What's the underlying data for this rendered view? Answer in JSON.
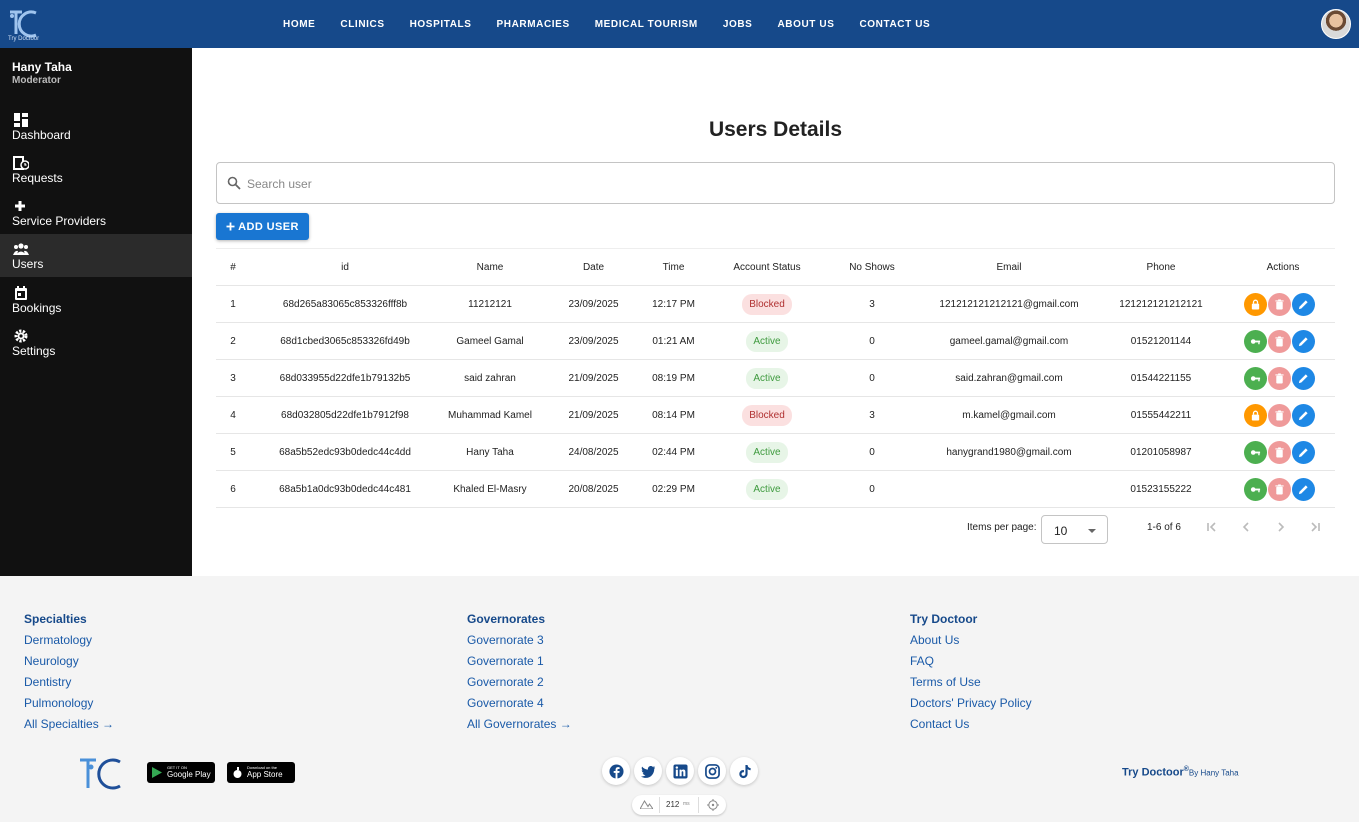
{
  "app": {
    "logo_text": "Try Doctoor",
    "nav": [
      "HOME",
      "CLINICS",
      "HOSPITALS",
      "PHARMACIES",
      "MEDICAL TOURISM",
      "JOBS",
      "ABOUT US",
      "CONTACT US"
    ]
  },
  "sidebar": {
    "user_name": "Hany Taha",
    "user_role": "Moderator",
    "items": [
      {
        "label": "Dashboard",
        "icon": "dashboard-icon"
      },
      {
        "label": "Requests",
        "icon": "requests-icon"
      },
      {
        "label": "Service Providers",
        "icon": "plus-icon"
      },
      {
        "label": "Users",
        "icon": "users-icon"
      },
      {
        "label": "Bookings",
        "icon": "calendar-icon"
      },
      {
        "label": "Settings",
        "icon": "gear-icon"
      }
    ],
    "active_index": 3
  },
  "main": {
    "title": "Users Details",
    "search_placeholder": "Search user",
    "add_button": "ADD USER",
    "columns": [
      "#",
      "id",
      "Name",
      "Date",
      "Time",
      "Account Status",
      "No Shows",
      "Email",
      "Phone",
      "Actions"
    ],
    "rows": [
      {
        "n": "1",
        "id": "68d265a83065c853326fff8b",
        "name": "11212121",
        "date": "23/09/2025",
        "time": "12:17 PM",
        "status": "Blocked",
        "no_shows": "3",
        "email": "121212121212121@gmail.com",
        "phone": "121212121212121"
      },
      {
        "n": "2",
        "id": "68d1cbed3065c853326fd49b",
        "name": "Gameel Gamal",
        "date": "23/09/2025",
        "time": "01:21 AM",
        "status": "Active",
        "no_shows": "0",
        "email": "gameel.gamal@gmail.com",
        "phone": "01521201144"
      },
      {
        "n": "3",
        "id": "68d033955d22dfe1b79132b5",
        "name": "said zahran",
        "date": "21/09/2025",
        "time": "08:19 PM",
        "status": "Active",
        "no_shows": "0",
        "email": "said.zahran@gmail.com",
        "phone": "01544221155"
      },
      {
        "n": "4",
        "id": "68d032805d22dfe1b7912f98",
        "name": "Muhammad Kamel",
        "date": "21/09/2025",
        "time": "08:14 PM",
        "status": "Blocked",
        "no_shows": "3",
        "email": "m.kamel@gmail.com",
        "phone": "01555442211"
      },
      {
        "n": "5",
        "id": "68a5b52edc93b0dedc44c4dd",
        "name": "Hany Taha",
        "date": "24/08/2025",
        "time": "02:44 PM",
        "status": "Active",
        "no_shows": "0",
        "email": "hanygrand1980@gmail.com",
        "phone": "01201058987"
      },
      {
        "n": "6",
        "id": "68a5b1a0dc93b0dedc44c481",
        "name": "Khaled El-Masry",
        "date": "20/08/2025",
        "time": "02:29 PM",
        "status": "Active",
        "no_shows": "0",
        "email": "",
        "phone": "01523155222"
      }
    ],
    "pager": {
      "items_per_page_label": "Items per page:",
      "items_per_page": "10",
      "range": "1-6 of 6"
    }
  },
  "footer": {
    "specialties": {
      "title": "Specialties",
      "links": [
        "Dermatology",
        "Neurology",
        "Dentistry",
        "Pulmonology",
        "All Specialties →"
      ]
    },
    "governorates": {
      "title": "Governorates",
      "links": [
        "Governorate 3",
        "Governorate 1",
        "Governorate 2",
        "Governorate 4",
        "All Governorates →"
      ]
    },
    "company": {
      "title": "Try Doctoor",
      "links": [
        "About Us",
        "FAQ",
        "Terms of Use",
        "Doctors' Privacy Policy",
        "Contact Us"
      ]
    },
    "google_play": {
      "small": "GET IT ON",
      "big": "Google Play"
    },
    "app_store": {
      "small": "Download on the",
      "big": "App Store"
    },
    "devbar_ms": "212",
    "devbar_unit": "ms",
    "brand": "Try Doctoor",
    "brand_mark": "®",
    "brand_by": "By Hany Taha"
  },
  "colors": {
    "nav_bg": "#16498a",
    "primary": "#1976d2",
    "sidebar_bg": "#111111",
    "blocked": "#b03030",
    "active": "#3e9a3e"
  }
}
